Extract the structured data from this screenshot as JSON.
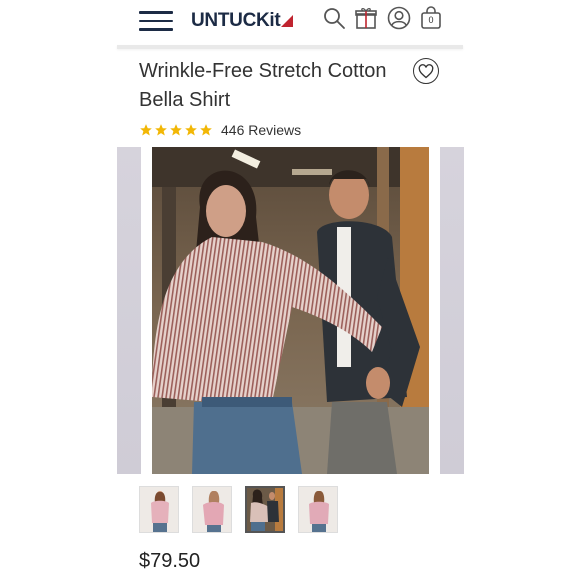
{
  "header": {
    "brand": "UNTUCKit",
    "icons": [
      "menu-icon",
      "search-icon",
      "gift-icon",
      "account-icon",
      "bag-icon"
    ],
    "bag_count": "0",
    "brand_color": "#1c2b45",
    "flag_color": "#c0242f"
  },
  "product": {
    "title": "Wrinkle-Free Stretch Cotton Bella Shirt",
    "rating": 5,
    "reviews": "446 Reviews",
    "price": "$79.50",
    "star_color": "#f2b705"
  },
  "gallery": {
    "thumbnail_count": 4,
    "selected_index": 2
  }
}
